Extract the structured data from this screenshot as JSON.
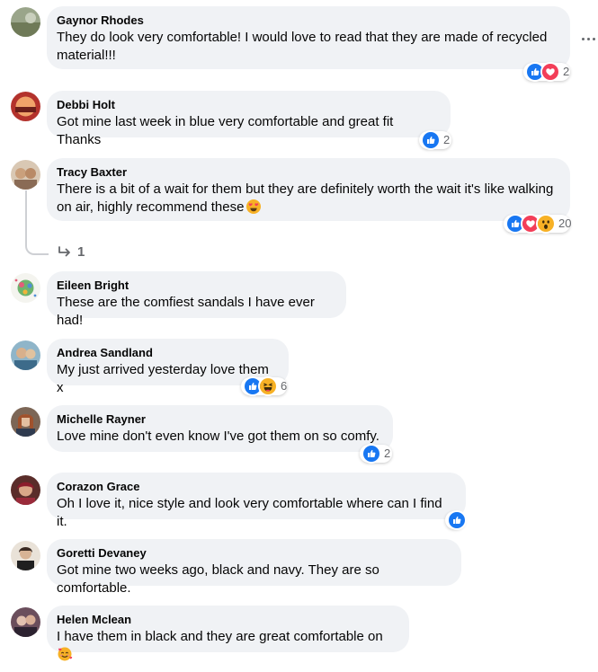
{
  "comments": [
    {
      "author": "Gaynor Rhodes",
      "text": "They do look very comfortable! I would love to read that they are made of recycled material!!!",
      "reactions": [
        "like",
        "love"
      ],
      "count": "2"
    },
    {
      "author": "Debbi Holt",
      "text": "Got mine last week in blue very comfortable and great fit Thanks",
      "reactions": [
        "like"
      ],
      "count": "2"
    },
    {
      "author": "Tracy Baxter",
      "text": "There is a bit of a wait for them but they are definitely worth the wait it's like walking on air, highly recommend these",
      "emoji": "heart-eyes-emoji",
      "reactions": [
        "like",
        "love",
        "wow"
      ],
      "count": "20",
      "reply_count": "1"
    },
    {
      "author": "Eileen Bright",
      "text": "These are the comfiest sandals I have ever had!"
    },
    {
      "author": "Andrea Sandland",
      "text": "My just arrived yesterday love them x",
      "reactions": [
        "like",
        "haha"
      ],
      "count": "6"
    },
    {
      "author": "Michelle Rayner",
      "text": "Love mine don't even know I've got them on so comfy.",
      "reactions": [
        "like"
      ],
      "count": "2"
    },
    {
      "author": "Corazon Grace",
      "text": "Oh I love it, nice style and look very comfortable where can I find it.",
      "reactions": [
        "like"
      ]
    },
    {
      "author": "Goretti Devaney",
      "text": "Got mine two weeks ago, black and navy. They are so comfortable."
    },
    {
      "author": "Helen Mclean",
      "text": "I have them in black and they are great comfortable on",
      "emoji": "smiling-face-with-hearts-emoji"
    }
  ],
  "colors": {
    "bubble": "#f0f2f5",
    "like": "#1877f2",
    "love": "#f33e58",
    "reaction_yellow": "#f7b125",
    "secondary_text": "#65676b"
  },
  "icons": {
    "more": "more-dots-icon",
    "reply_arrow": "reply-arrow-icon"
  }
}
